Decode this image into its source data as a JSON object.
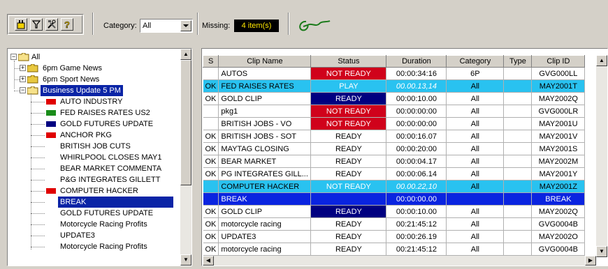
{
  "toolbar": {
    "category_label": "Category:",
    "category_value": "All",
    "missing_label": "Missing:",
    "missing_value": "4 item(s)",
    "buttons": [
      "new-icon",
      "filter-icon",
      "tools-icon",
      "help-icon"
    ]
  },
  "tree": {
    "root": "All",
    "groups": [
      {
        "label": "6pm Game News"
      },
      {
        "label": "6pm Sport News"
      },
      {
        "label": "Business Update 5 PM"
      }
    ],
    "items": [
      {
        "label": "AUTO INDUSTRY",
        "marker": "#e00000"
      },
      {
        "label": "FED RAISES RATES US2",
        "marker": "#1a8c1a"
      },
      {
        "label": "GOLD FUTURES UPDATE",
        "marker": "#000080"
      },
      {
        "label": "ANCHOR PKG",
        "marker": "#e00000"
      },
      {
        "label": "BRITISH JOB CUTS",
        "marker": ""
      },
      {
        "label": "WHIRLPOOL CLOSES MAY1",
        "marker": ""
      },
      {
        "label": "BEAR MARKET COMMENTA",
        "marker": ""
      },
      {
        "label": "P&G INTEGRATES GILLETT",
        "marker": ""
      },
      {
        "label": "COMPUTER HACKER",
        "marker": "#e00000"
      },
      {
        "label": "BREAK",
        "marker": ""
      },
      {
        "label": "GOLD FUTURES UPDATE",
        "marker": ""
      },
      {
        "label": "Motorcycle Racing Profits",
        "marker": ""
      },
      {
        "label": "UPDATE3",
        "marker": ""
      },
      {
        "label": "Motorcycle Racing Profits",
        "marker": ""
      }
    ]
  },
  "grid": {
    "headers": [
      "S",
      "Clip Name",
      "Status",
      "Duration",
      "Category",
      "Type",
      "Clip ID"
    ],
    "rows": [
      {
        "s": "",
        "name": "AUTOS",
        "status": "NOT READY",
        "duration": "00:00:34:16",
        "category": "6P",
        "type": "",
        "id": "GVG000LL"
      },
      {
        "s": "OK",
        "name": "FED RAISES RATES",
        "status": "PLAY",
        "duration": "00.00.13,14",
        "category": "All",
        "type": "",
        "id": "MAY2001T"
      },
      {
        "s": "OK",
        "name": "GOLD CLIP",
        "status": "READY",
        "duration": "00:00:10.00",
        "category": "All",
        "type": "",
        "id": "MAY2002Q"
      },
      {
        "s": "",
        "name": "pkg1",
        "status": "NOT READY",
        "duration": "00:00:00:00",
        "category": "All",
        "type": "",
        "id": "GVG000LR"
      },
      {
        "s": "",
        "name": "BRITISH JOBS - VO",
        "status": "NOT READY",
        "duration": "00:00:00:00",
        "category": "All",
        "type": "",
        "id": "MAY2001U"
      },
      {
        "s": "OK",
        "name": "BRITISH JOBS - SOT",
        "status": "READY",
        "duration": "00:00:16.07",
        "category": "All",
        "type": "",
        "id": "MAY2001V"
      },
      {
        "s": "OK",
        "name": "MAYTAG CLOSING",
        "status": "READY",
        "duration": "00:00:20:00",
        "category": "All",
        "type": "",
        "id": "MAY2001S"
      },
      {
        "s": "OK",
        "name": "BEAR MARKET",
        "status": "READY",
        "duration": "00:00:04.17",
        "category": "All",
        "type": "",
        "id": "MAY2002M"
      },
      {
        "s": "OK",
        "name": "PG INTEGRATES GILL...",
        "status": "READY",
        "duration": "00:00:06.14",
        "category": "All",
        "type": "",
        "id": "MAY2001Y"
      },
      {
        "s": "",
        "name": "COMPUTER HACKER",
        "status": "NOT READY",
        "duration": "00.00.22,10",
        "category": "All",
        "type": "",
        "id": "MAY2001Z"
      },
      {
        "s": "",
        "name": "BREAK",
        "status": "",
        "duration": "00:00:00.00",
        "category": "",
        "type": "",
        "id": "BREAK"
      },
      {
        "s": "OK",
        "name": "GOLD CLIP",
        "status": "READY",
        "duration": "00:00:10.00",
        "category": "All",
        "type": "",
        "id": "MAY2002Q"
      },
      {
        "s": "OK",
        "name": "motorcycle racing",
        "status": "READY",
        "duration": "00:21:45:12",
        "category": "All",
        "type": "",
        "id": "GVG0004B"
      },
      {
        "s": "OK",
        "name": "UPDATE3",
        "status": "READY",
        "duration": "00:00:26.19",
        "category": "All",
        "type": "",
        "id": "MAY2002O"
      },
      {
        "s": "OK",
        "name": "motorcycle racing",
        "status": "READY",
        "duration": "00:21:45:12",
        "category": "All",
        "type": "",
        "id": "GVG0004B"
      }
    ]
  }
}
